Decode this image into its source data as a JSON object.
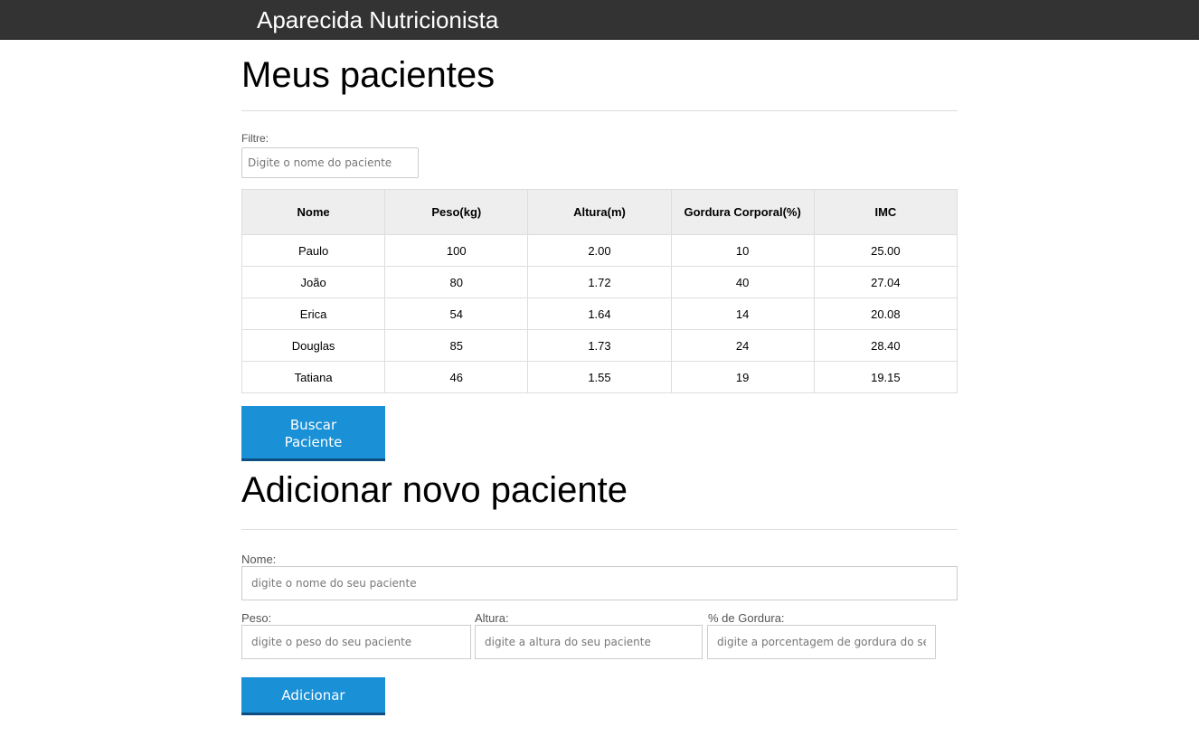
{
  "header": {
    "brand": "Aparecida Nutricionista"
  },
  "patients": {
    "title": "Meus pacientes",
    "filter_label": "Filtre:",
    "filter_placeholder": "Digite o nome do paciente",
    "columns": [
      "Nome",
      "Peso(kg)",
      "Altura(m)",
      "Gordura Corporal(%)",
      "IMC"
    ],
    "rows": [
      [
        "Paulo",
        "100",
        "2.00",
        "10",
        "25.00"
      ],
      [
        "João",
        "80",
        "1.72",
        "40",
        "27.04"
      ],
      [
        "Erica",
        "54",
        "1.64",
        "14",
        "20.08"
      ],
      [
        "Douglas",
        "85",
        "1.73",
        "24",
        "28.40"
      ],
      [
        "Tatiana",
        "46",
        "1.55",
        "19",
        "19.15"
      ]
    ],
    "search_button": "Buscar Paciente"
  },
  "add_form": {
    "title": "Adicionar novo paciente",
    "name_label": "Nome:",
    "name_placeholder": "digite o nome do seu paciente",
    "weight_label": "Peso:",
    "weight_placeholder": "digite o peso do seu paciente",
    "height_label": "Altura:",
    "height_placeholder": "digite a altura do seu paciente",
    "fat_label": "% de Gordura:",
    "fat_placeholder": "digite a porcentagem de gordura do seu paciente",
    "submit_button": "Adicionar"
  },
  "colors": {
    "header_bg": "#333333",
    "button_bg": "#1a90d6",
    "table_header_bg": "#eeeeee"
  }
}
